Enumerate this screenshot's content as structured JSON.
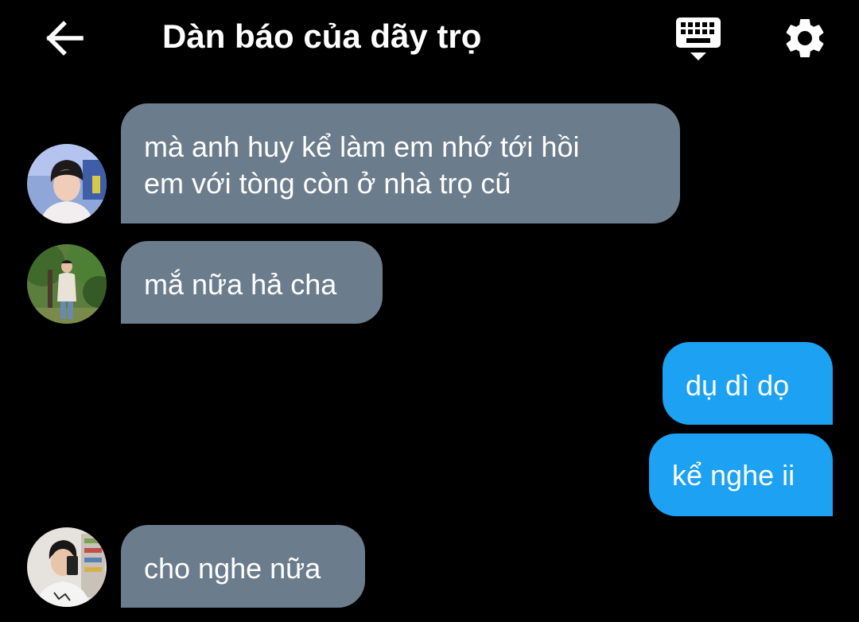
{
  "header": {
    "title": "Dàn báo của dãy trọ",
    "back_icon": "arrow-left-icon",
    "keyboard_icon": "keyboard-hide-icon",
    "settings_icon": "gear-icon"
  },
  "colors": {
    "background": "#000000",
    "incoming_bubble": "#6b7c8c",
    "outgoing_bubble": "#1da1f2",
    "text": "#ffffff"
  },
  "messages": [
    {
      "direction": "incoming",
      "avatar": "avatar-1",
      "lines": [
        "mà anh huy kể làm em nhớ tới hồi",
        "em với tòng còn ở nhà trọ cũ"
      ]
    },
    {
      "direction": "incoming",
      "avatar": "avatar-2",
      "lines": [
        "mắ nữa hả cha"
      ]
    },
    {
      "direction": "outgoing",
      "lines": [
        "dụ dì dọ"
      ]
    },
    {
      "direction": "outgoing",
      "lines": [
        "kể nghe ii"
      ]
    },
    {
      "direction": "incoming",
      "avatar": "avatar-3",
      "lines": [
        "cho nghe nữa"
      ]
    }
  ]
}
